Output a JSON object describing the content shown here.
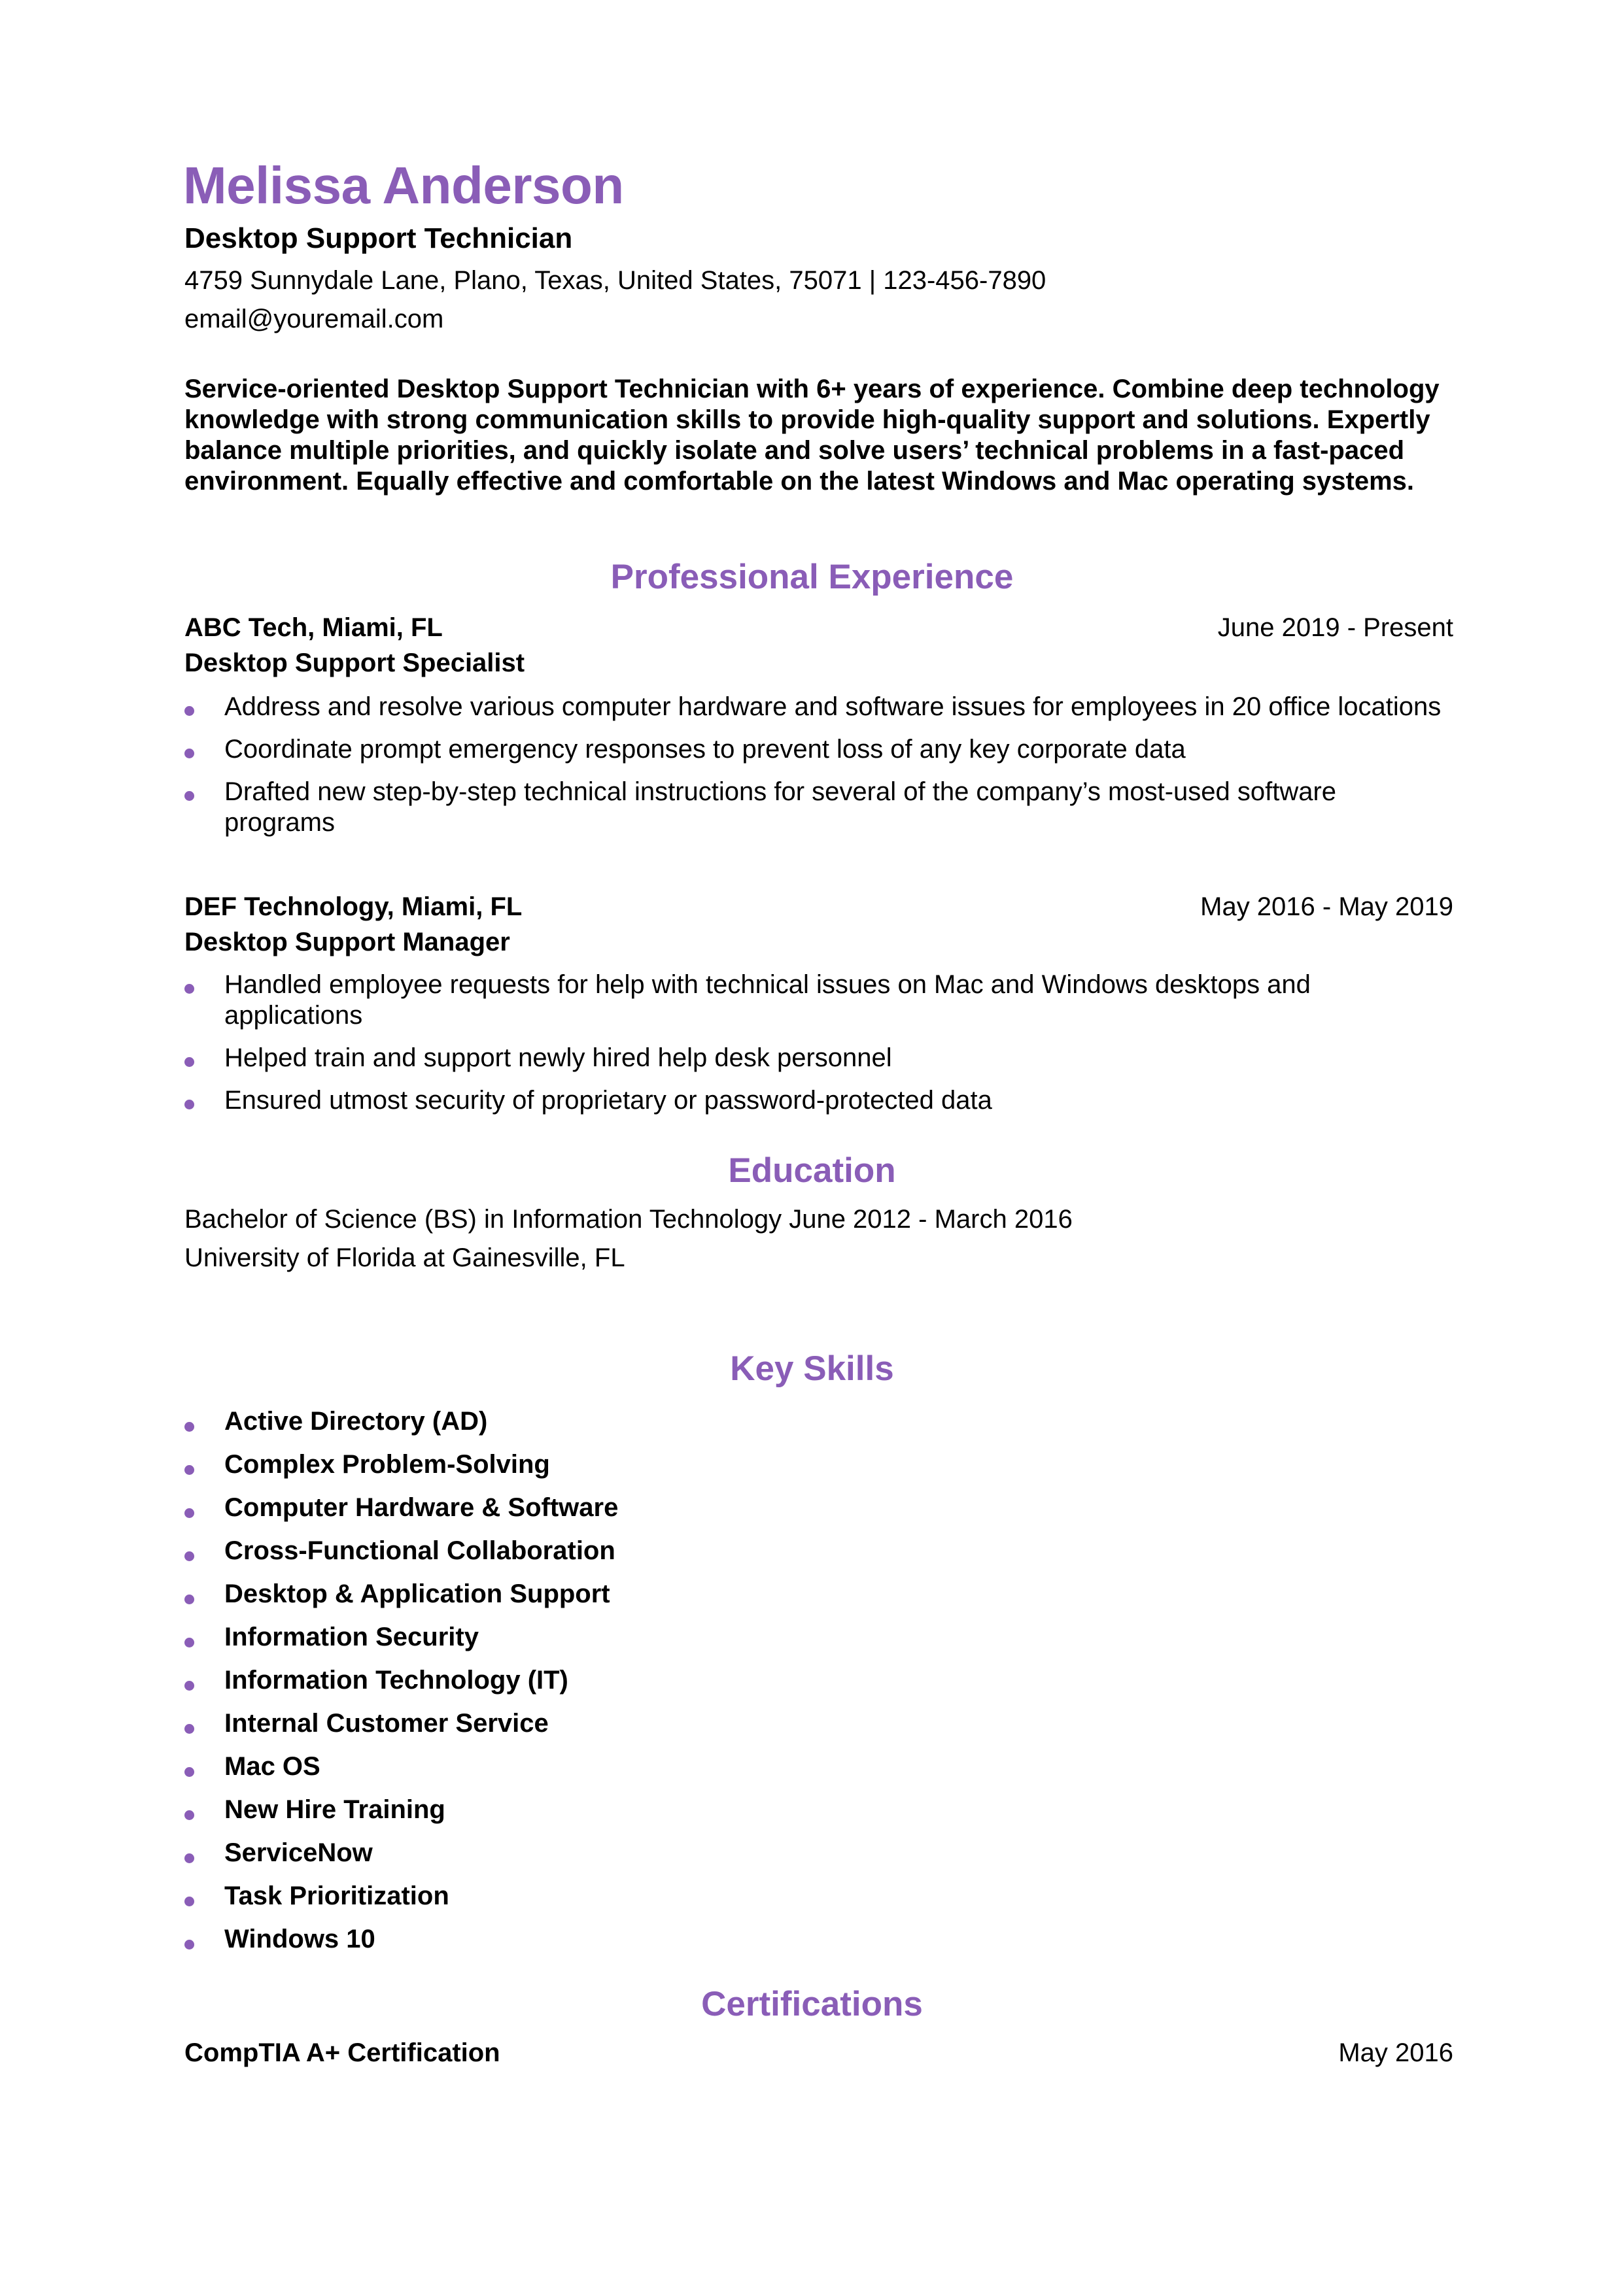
{
  "header": {
    "name": "Melissa Anderson",
    "title": "Desktop Support Technician",
    "address_phone": "4759 Sunnydale Lane, Plano, Texas, United States, 75071 | 123-456-7890",
    "email": "email@youremail.com"
  },
  "summary": "Service-oriented Desktop Support Technician with 6+ years of experience. Combine deep technology knowledge with strong communication skills to provide high-quality support and solutions. Expertly balance multiple priorities, and quickly isolate and solve users’ technical problems in a fast-paced environment. Equally effective and comfortable on the latest Windows and Mac operating systems.",
  "colors": {
    "accent": "#8a5db7",
    "text": "#000000"
  },
  "experience": {
    "heading": "Professional Experience",
    "jobs": [
      {
        "company": "ABC Tech, Miami, FL",
        "dates": "June 2019 - Present",
        "role": "Desktop Support Specialist",
        "bullets": [
          "Address and resolve various computer hardware and software issues for employees in 20 office locations",
          "Coordinate prompt emergency responses to prevent loss of any key corporate data",
          "Drafted new step-by-step technical instructions for several of the company’s most-used software programs"
        ]
      },
      {
        "company": "DEF Technology, Miami, FL",
        "dates": "May 2016 - May 2019",
        "role": "Desktop Support Manager",
        "bullets": [
          "Handled employee requests for help with technical issues on Mac and Windows desktops and applications",
          "Helped train and support newly hired help desk personnel",
          "Ensured utmost security of proprietary or password-protected data"
        ]
      }
    ]
  },
  "education": {
    "heading": "Education",
    "degree_line": "Bachelor of Science (BS) in Information Technology June 2012 - March 2016",
    "school_line": "University of Florida at Gainesville, FL"
  },
  "skills": {
    "heading": "Key Skills",
    "items": [
      "Active Directory (AD)",
      "Complex Problem-Solving",
      "Computer Hardware & Software",
      "Cross-Functional Collaboration",
      "Desktop & Application Support",
      "Information Security",
      "Information Technology (IT)",
      "Internal Customer Service",
      "Mac OS",
      "New Hire Training",
      "ServiceNow",
      "Task Prioritization",
      "Windows 10"
    ]
  },
  "certifications": {
    "heading": "Certifications",
    "items": [
      {
        "name": "CompTIA A+ Certification",
        "date": "May 2016"
      }
    ]
  }
}
